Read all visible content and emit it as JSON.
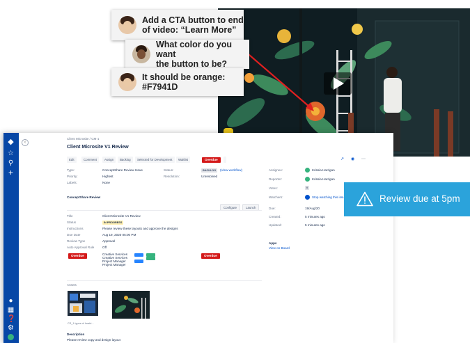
{
  "chat": [
    {
      "lines": [
        "Add a CTA button to end",
        "of video: “Learn More”"
      ],
      "avatar": "woman-avatar"
    },
    {
      "lines": [
        "What color do you want",
        "the button to be?"
      ],
      "avatar": "man-avatar"
    },
    {
      "lines": [
        "It should be orange:",
        "#F7941D"
      ],
      "avatar": "woman-avatar"
    }
  ],
  "notification": {
    "text": "Review due at 5pm",
    "icon": "warning-triangle-icon",
    "color": "#2BA3DB"
  },
  "colors": {
    "accent_orange": "#F7941D",
    "overdue_red": "#D41A1A",
    "jira_blue": "#0747A6"
  },
  "jira": {
    "breadcrumb": "Client Microsite  /  CM-1",
    "title": "Client Microsite V1 Review",
    "toolbar": [
      "Edit",
      "Comment",
      "Assign",
      "Backlog",
      "Selected for Development",
      "Waitlist"
    ],
    "toolbar_overdue": "Overdue",
    "toolbar_more": "",
    "fields_left": [
      {
        "label": "Type:",
        "value": "ConceptShare Review Issue"
      },
      {
        "label": "Priority:",
        "value": "Highest"
      },
      {
        "label": "Labels:",
        "value": "None"
      }
    ],
    "fields_mid": [
      {
        "label": "Status:",
        "value": "BACKLOG",
        "extra": "(View workflow)"
      },
      {
        "label": "Resolution:",
        "value": "Unresolved"
      }
    ],
    "section_title": "ConceptShare Review",
    "configure_label": "Configure",
    "launch_label": "Launch",
    "review_rows": [
      {
        "label": "Title",
        "value": "Client Microsite V1 Review"
      },
      {
        "label": "Status",
        "value": "IN PROGRESS"
      },
      {
        "label": "Instructions",
        "value": "Please review these layouts and approve the designs"
      },
      {
        "label": "Due Date",
        "value": "Aug 19, 2020 05:00 PM"
      },
      {
        "label": "Review Type",
        "value": "Approval"
      },
      {
        "label": "Auto Approval Rule",
        "value": "Off"
      }
    ],
    "overdue_label": "Overdue",
    "reviewers": [
      "Creative Services",
      "Creative Services",
      "Project Manager",
      "Project Manager"
    ],
    "assets_title": "Assets",
    "asset_caption": "CS_1 types of Imatri...",
    "description_title": "Description",
    "description_text": "Please review copy and design layout",
    "people": [
      {
        "label": "Assignee:",
        "value": "Krissia Harrigan"
      },
      {
        "label": "Reporter:",
        "value": "Krissia Harrigan"
      },
      {
        "label": "Votes:",
        "value": "0"
      },
      {
        "label": "Watchers:",
        "value": "Stop watching this issue"
      }
    ],
    "dates": [
      {
        "label": "Due:",
        "value": "19/Aug/20"
      },
      {
        "label": "Created:",
        "value": "5 minutes ago"
      },
      {
        "label": "Updated:",
        "value": "5 minutes ago"
      }
    ],
    "apps_title": "Apps",
    "apps_link": "View on Board"
  }
}
